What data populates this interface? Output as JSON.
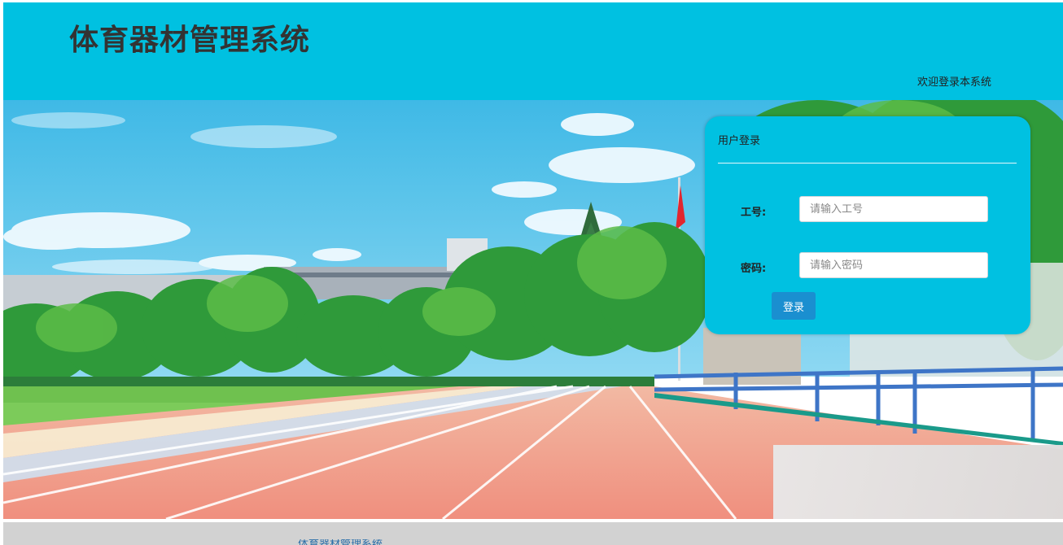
{
  "header": {
    "title": "体育器材管理系统",
    "welcome": "欢迎登录本系统"
  },
  "login": {
    "title": "用户登录",
    "id_label": "工号:",
    "id_placeholder": "请输入工号",
    "password_label": "密码:",
    "password_placeholder": "请输入密码",
    "submit_label": "登录"
  },
  "footer": {
    "text": "体育器材管理系统"
  },
  "colors": {
    "header_bg": "#00c1e1",
    "login_panel_bg": "#00c1e1",
    "button_bg": "#1a8fd0"
  }
}
